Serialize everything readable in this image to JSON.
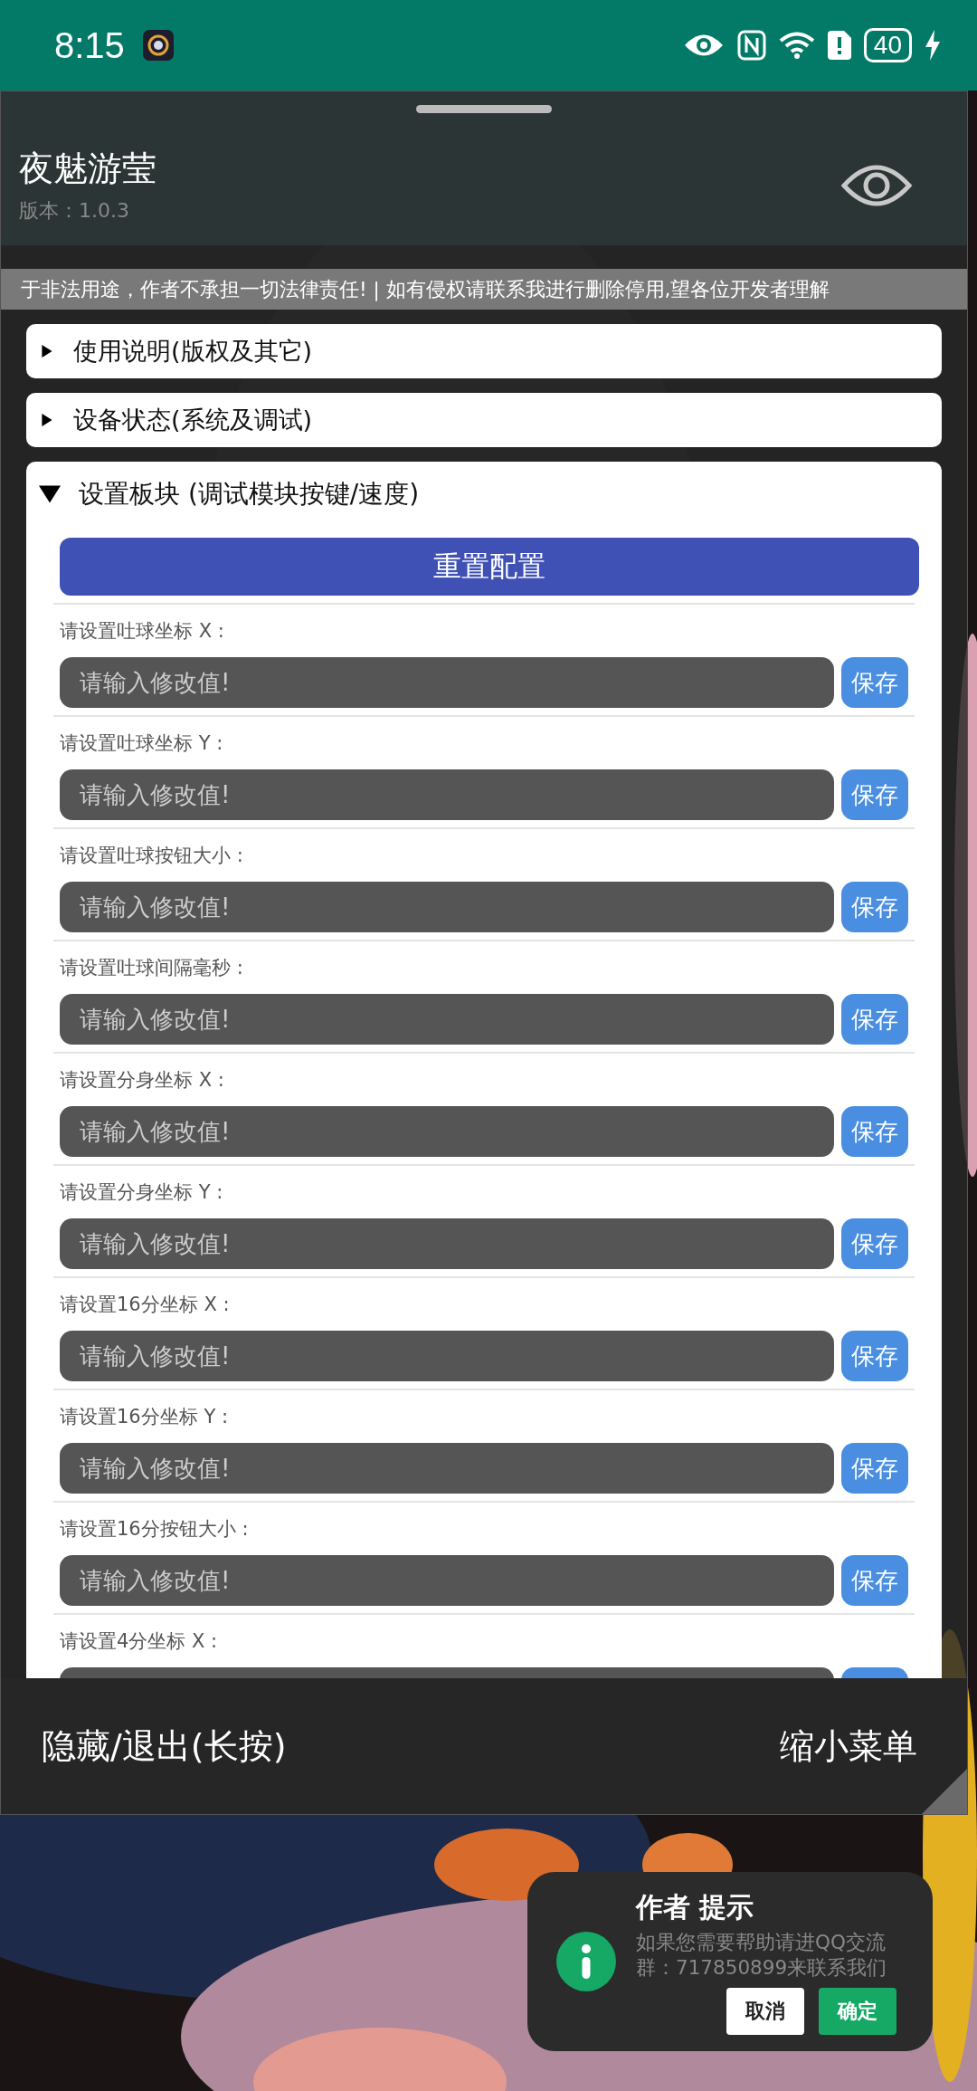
{
  "status_bar": {
    "time": "8:15",
    "battery": "40"
  },
  "menu": {
    "title": "夜魅游莹",
    "version": "版本：1.0.3",
    "notice": "于非法用途，作者不承担一切法律责任! | 如有侵权请联系我进行删除停用,望各位开发者理解",
    "sections": [
      {
        "title": "使用说明(版权及其它)",
        "expanded": false
      },
      {
        "title": "设备状态(系统及调试)",
        "expanded": false
      },
      {
        "title": "设置板块 (调试模块按键/速度)",
        "expanded": true
      }
    ],
    "reset_button": "重置配置",
    "settings": [
      {
        "label": "请设置吐球坐标 X :",
        "placeholder": "请输入修改值!",
        "button": "保存"
      },
      {
        "label": "请设置吐球坐标 Y :",
        "placeholder": "请输入修改值!",
        "button": "保存"
      },
      {
        "label": "请设置吐球按钮大小 :",
        "placeholder": "请输入修改值!",
        "button": "保存"
      },
      {
        "label": "请设置吐球间隔毫秒 :",
        "placeholder": "请输入修改值!",
        "button": "保存"
      },
      {
        "label": "请设置分身坐标 X :",
        "placeholder": "请输入修改值!",
        "button": "保存"
      },
      {
        "label": "请设置分身坐标 Y :",
        "placeholder": "请输入修改值!",
        "button": "保存"
      },
      {
        "label": "请设置16分坐标 X :",
        "placeholder": "请输入修改值!",
        "button": "保存"
      },
      {
        "label": "请设置16分坐标 Y :",
        "placeholder": "请输入修改值!",
        "button": "保存"
      },
      {
        "label": "请设置16分按钮大小 :",
        "placeholder": "请输入修改值!",
        "button": "保存"
      },
      {
        "label": "请设置4分坐标 X :"
      }
    ],
    "hide_button": "隐藏/退出(长按)",
    "shrink_button": "缩小菜单"
  },
  "toast": {
    "title": "作者 提示",
    "message": "如果您需要帮助请进QQ交流群：717850899来联系我们",
    "buttons": [
      "取消",
      "确定"
    ]
  }
}
